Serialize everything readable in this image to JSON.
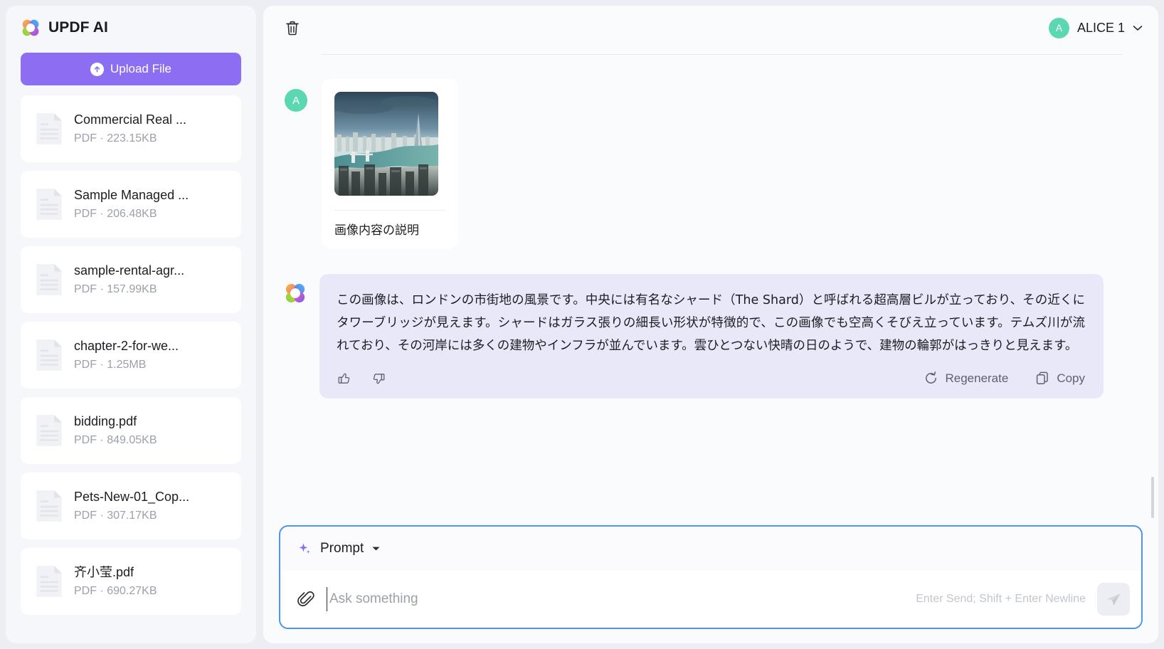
{
  "sidebar": {
    "brand": "UPDF AI",
    "brand_logo_icon": "updf-flower-logo",
    "upload_label": "Upload File",
    "upload_icon": "upload-arrow-icon",
    "files": [
      {
        "name": "Commercial Real ...",
        "meta": "PDF · 223.15KB",
        "icon": "pdf-file-icon"
      },
      {
        "name": "Sample Managed ...",
        "meta": "PDF · 206.48KB",
        "icon": "pdf-file-icon"
      },
      {
        "name": "sample-rental-agr...",
        "meta": "PDF · 157.99KB",
        "icon": "pdf-file-icon"
      },
      {
        "name": "chapter-2-for-we...",
        "meta": "PDF · 1.25MB",
        "icon": "pdf-file-icon"
      },
      {
        "name": "bidding.pdf",
        "meta": "PDF · 849.05KB",
        "icon": "pdf-file-icon"
      },
      {
        "name": "Pets-New-01_Cop...",
        "meta": "PDF · 307.17KB",
        "icon": "pdf-file-icon"
      },
      {
        "name": "齐小莹.pdf",
        "meta": "PDF · 690.27KB",
        "icon": "pdf-file-icon"
      }
    ]
  },
  "header": {
    "trash_icon": "trash-icon",
    "user_initial": "A",
    "user_name": "ALICE 1",
    "caret_icon": "chevron-down-icon"
  },
  "chat": {
    "user_message": {
      "avatar_initial": "A",
      "thumbnail_icon": "london-skyline-thumbnail",
      "caption": "画像内容の説明"
    },
    "assistant_message": {
      "avatar_icon": "updf-flower-logo",
      "text": "この画像は、ロンドンの市街地の風景です。中央には有名なシャード（The Shard）と呼ばれる超高層ビルが立っており、その近くにタワーブリッジが見えます。シャードはガラス張りの細長い形状が特徴的で、この画像でも空高くそびえ立っています。テムズ川が流れており、その河岸には多くの建物やインフラが並んでいます。雲ひとつない快晴の日のようで、建物の輪郭がはっきりと見えます。",
      "thumbs_up_icon": "thumbs-up-icon",
      "thumbs_down_icon": "thumbs-down-icon",
      "regenerate_label": "Regenerate",
      "regenerate_icon": "refresh-icon",
      "copy_label": "Copy",
      "copy_icon": "copy-icon"
    }
  },
  "composer": {
    "prompt_label": "Prompt",
    "prompt_icon": "sparkle-icon",
    "prompt_caret_icon": "caret-down-icon",
    "attach_icon": "paperclip-icon",
    "input_value": "",
    "input_placeholder": "Ask something",
    "hint": "Enter Send; Shift + Enter Newline",
    "send_icon": "send-paper-plane-icon"
  },
  "colors": {
    "accent_purple": "#8c6ef2",
    "focus_blue": "#4d96e8",
    "avatar_green": "#5bd8b1",
    "ai_bubble": "#e8e8f8"
  }
}
